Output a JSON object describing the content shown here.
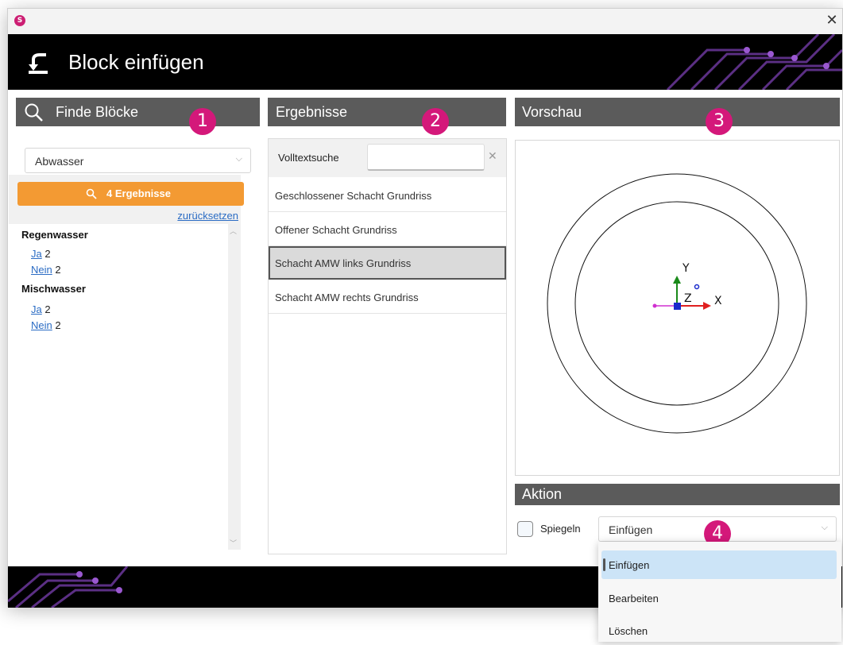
{
  "window": {
    "title": "Block einfügen",
    "close_glyph": "✕",
    "app_icon_letter": "S"
  },
  "left": {
    "header": "Finde Blöcke",
    "badge": "1",
    "combo_value": "Abwasser",
    "results_button": "4 Ergebnisse",
    "reset_link": "zurücksetzen",
    "groups": [
      {
        "title": "Regenwasser",
        "options": [
          {
            "link": "Ja",
            "count": "2"
          },
          {
            "link": "Nein",
            "count": "2"
          }
        ]
      },
      {
        "title": "Mischwasser",
        "options": [
          {
            "link": "Ja",
            "count": "2"
          },
          {
            "link": "Nein",
            "count": "2"
          }
        ]
      }
    ]
  },
  "middle": {
    "header": "Ergebnisse",
    "badge": "2",
    "search_label": "Volltextsuche",
    "search_value": "",
    "clear_glyph": "✕",
    "results": [
      "Geschlossener Schacht Grundriss",
      "Offener Schacht Grundriss",
      "Schacht AMW links Grundriss",
      "Schacht AMW rechts Grundriss"
    ],
    "selected_index": 2
  },
  "preview": {
    "header": "Vorschau",
    "badge": "3",
    "axis_x": "X",
    "axis_y": "Y",
    "axis_z": "Z"
  },
  "action": {
    "header": "Aktion",
    "badge": "4",
    "mirror_label": "Spiegeln",
    "mirror_checked": false,
    "select_value": "Einfügen",
    "options": [
      "Einfügen",
      "Bearbeiten",
      "Löschen"
    ]
  },
  "icons": [
    "app-logo-icon",
    "block-insert-icon",
    "search-icon",
    "chevron-down-icon",
    "close-icon",
    "scroll-up-icon",
    "scroll-down-icon"
  ],
  "colors": {
    "header_gray": "#5b5b5b",
    "badge_pink": "#d4187a",
    "orange_button": "#f39a33",
    "link_blue": "#2b6cc4",
    "dropdown_highlight": "#cce4f7"
  }
}
